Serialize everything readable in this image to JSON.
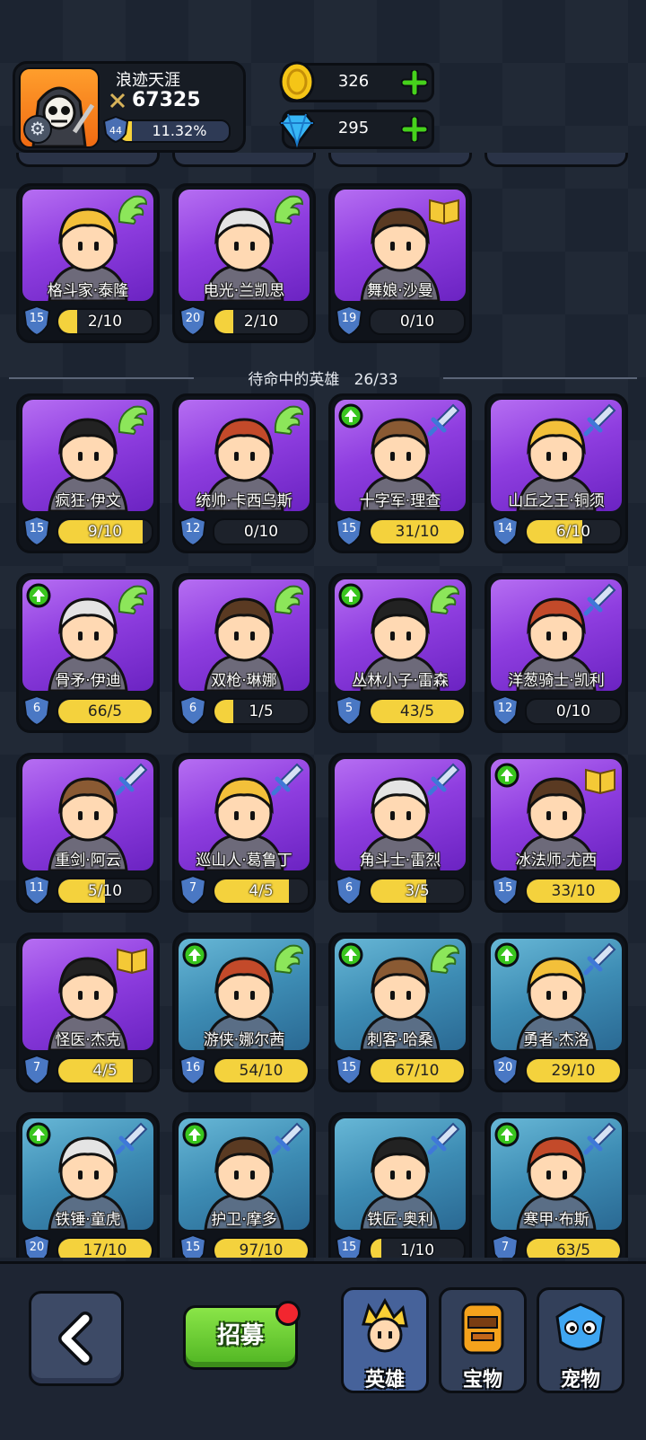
{
  "player": {
    "name": "浪迹天涯",
    "power": "67325",
    "level": "44",
    "xp_percent": "11.32%",
    "xp_fraction": 0.1132
  },
  "currency": {
    "gold": "326",
    "gems": "295"
  },
  "owned_heroes": [
    {
      "name": "格斗家·泰隆",
      "level": "15",
      "progress": "2/10",
      "fill": 0.2,
      "class": "wing",
      "upgrade": false,
      "bg": "purple"
    },
    {
      "name": "电光·兰凯思",
      "level": "20",
      "progress": "2/10",
      "fill": 0.2,
      "class": "wing",
      "upgrade": false,
      "bg": "purple"
    },
    {
      "name": "舞娘·沙曼",
      "level": "19",
      "progress": "0/10",
      "fill": 0.0,
      "class": "book",
      "upgrade": false,
      "bg": "purple"
    }
  ],
  "standby": {
    "title": "待命中的英雄",
    "count": "26/33"
  },
  "standby_heroes": [
    {
      "name": "疯狂·伊文",
      "level": "15",
      "progress": "9/10",
      "fill": 0.9,
      "class": "wing",
      "upgrade": false,
      "bg": "purple"
    },
    {
      "name": "统帅·卡西乌斯",
      "level": "12",
      "progress": "0/10",
      "fill": 0.0,
      "class": "wing",
      "upgrade": false,
      "bg": "purple"
    },
    {
      "name": "十字军·理查",
      "level": "15",
      "progress": "31/10",
      "fill": 1.0,
      "class": "sword",
      "upgrade": true,
      "bg": "purple"
    },
    {
      "name": "山丘之王·铜须",
      "level": "14",
      "progress": "6/10",
      "fill": 0.6,
      "class": "sword",
      "upgrade": false,
      "bg": "purple"
    },
    {
      "name": "骨矛·伊迪",
      "level": "6",
      "progress": "66/5",
      "fill": 1.0,
      "class": "wing",
      "upgrade": true,
      "bg": "purple"
    },
    {
      "name": "双枪·琳娜",
      "level": "6",
      "progress": "1/5",
      "fill": 0.2,
      "class": "wing",
      "upgrade": false,
      "bg": "purple"
    },
    {
      "name": "丛林小子·雷森",
      "level": "5",
      "progress": "43/5",
      "fill": 1.0,
      "class": "wing",
      "upgrade": true,
      "bg": "purple"
    },
    {
      "name": "洋葱骑士·凯利",
      "level": "12",
      "progress": "0/10",
      "fill": 0.0,
      "class": "sword",
      "upgrade": false,
      "bg": "purple"
    },
    {
      "name": "重剑·阿云",
      "level": "11",
      "progress": "5/10",
      "fill": 0.5,
      "class": "sword",
      "upgrade": false,
      "bg": "purple"
    },
    {
      "name": "巡山人·葛鲁丁",
      "level": "7",
      "progress": "4/5",
      "fill": 0.8,
      "class": "sword",
      "upgrade": false,
      "bg": "purple"
    },
    {
      "name": "角斗士·雷烈",
      "level": "6",
      "progress": "3/5",
      "fill": 0.6,
      "class": "sword",
      "upgrade": false,
      "bg": "purple"
    },
    {
      "name": "冰法师·尤西",
      "level": "15",
      "progress": "33/10",
      "fill": 1.0,
      "class": "book",
      "upgrade": true,
      "bg": "purple"
    },
    {
      "name": "怪医·杰克",
      "level": "7",
      "progress": "4/5",
      "fill": 0.8,
      "class": "book",
      "upgrade": false,
      "bg": "purple"
    },
    {
      "name": "游侠·娜尔茜",
      "level": "16",
      "progress": "54/10",
      "fill": 1.0,
      "class": "wing",
      "upgrade": true,
      "bg": "blue"
    },
    {
      "name": "刺客·哈桑",
      "level": "15",
      "progress": "67/10",
      "fill": 1.0,
      "class": "wing",
      "upgrade": true,
      "bg": "blue"
    },
    {
      "name": "勇者·杰洛",
      "level": "20",
      "progress": "29/10",
      "fill": 1.0,
      "class": "sword",
      "upgrade": true,
      "bg": "blue"
    },
    {
      "name": "铁锤·童虎",
      "level": "20",
      "progress": "17/10",
      "fill": 1.0,
      "class": "sword",
      "upgrade": true,
      "bg": "blue"
    },
    {
      "name": "护卫·摩多",
      "level": "15",
      "progress": "97/10",
      "fill": 1.0,
      "class": "sword",
      "upgrade": true,
      "bg": "blue"
    },
    {
      "name": "铁匠·奥利",
      "level": "15",
      "progress": "1/10",
      "fill": 0.1,
      "class": "sword",
      "upgrade": false,
      "bg": "blue"
    },
    {
      "name": "寒甲·布斯",
      "level": "7",
      "progress": "63/5",
      "fill": 1.0,
      "class": "sword",
      "upgrade": true,
      "bg": "blue"
    }
  ],
  "bottom": {
    "recruit_label": "招募",
    "tabs": [
      {
        "label": "英雄",
        "icon": "hero-icon",
        "active": true
      },
      {
        "label": "宝物",
        "icon": "treasure-icon",
        "active": false
      },
      {
        "label": "宠物",
        "icon": "pet-icon",
        "active": false
      }
    ]
  },
  "colors": {
    "purple_card": "#8f3ee0",
    "blue_card": "#3d8cb4",
    "progress_fill": "#f4d23d",
    "upgrade_green": "#39c51e"
  }
}
